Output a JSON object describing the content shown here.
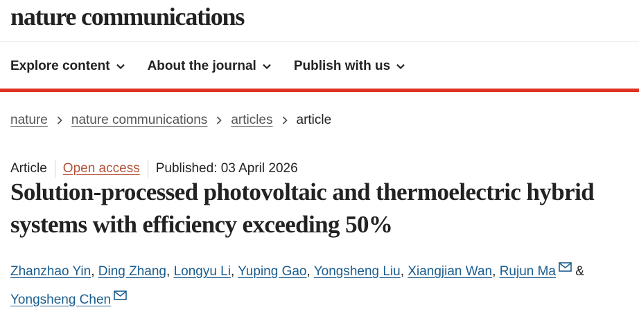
{
  "site": {
    "logo": "nature communications"
  },
  "nav": {
    "items": [
      {
        "label": "Explore content",
        "icon": "chevron-down-icon"
      },
      {
        "label": "About the journal",
        "icon": "chevron-down-icon"
      },
      {
        "label": "Publish with us",
        "icon": "chevron-down-icon"
      }
    ]
  },
  "breadcrumb": {
    "items": [
      "nature",
      "nature communications",
      "articles"
    ],
    "current": "article"
  },
  "article": {
    "type": "Article",
    "access": "Open access",
    "published_label": "Published:",
    "published_date": "03 April 2026",
    "title": "Solution-processed photovoltaic and thermoelectric hybrid systems with efficiency exceeding 50%",
    "authors": [
      "Zhanzhao Yin",
      "Ding Zhang",
      "Longyu Li",
      "Yuping Gao",
      "Yongsheng Liu",
      "Xiangjian Wan",
      "Rujun Ma",
      "Yongsheng Chen"
    ],
    "author_sep": ",",
    "amp": "&"
  },
  "colors": {
    "accent_red": "#e0321f",
    "link_blue": "#1a5d8f",
    "open_access": "#b5543a"
  }
}
